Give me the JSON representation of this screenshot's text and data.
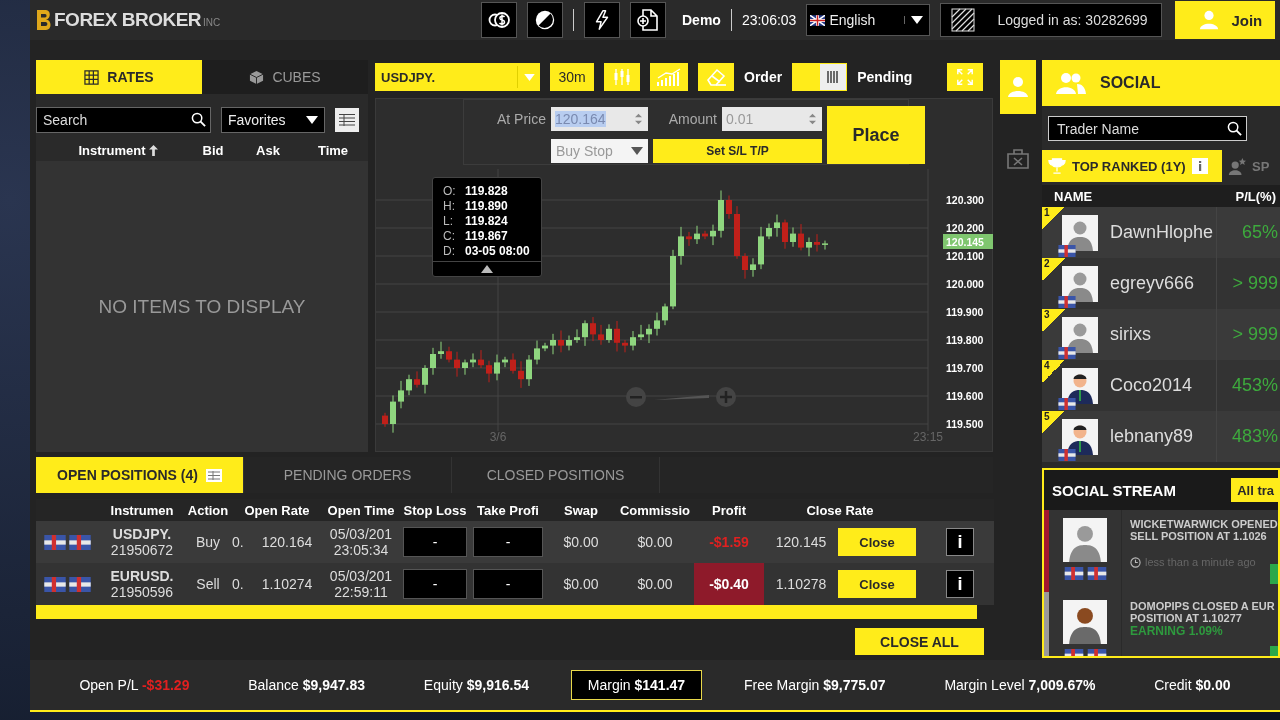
{
  "header": {
    "brand": "FOREX BROKER",
    "brand_suffix": "INC",
    "mode": "Demo",
    "time": "23:06:03",
    "language": "English",
    "logged_in": "Logged in as: 30282699",
    "join": "Join"
  },
  "rates_panel": {
    "tabs": [
      {
        "label": "RATES",
        "selected": true
      },
      {
        "label": "CUBES",
        "selected": false
      }
    ],
    "search": {
      "placeholder": "Search"
    },
    "filter": "Favorites",
    "columns": [
      "Instrument",
      "Bid",
      "Ask",
      "Time"
    ],
    "empty_message": "NO ITEMS TO DISPLAY"
  },
  "chart_panel": {
    "symbol": "USDJPY.",
    "timeframe": "30m",
    "order_label": "Order",
    "pending_label": "Pending",
    "pending": true,
    "order_form": {
      "price_label": "At Price",
      "price": "120.164",
      "amount_label": "Amount",
      "amount": "0.01",
      "order_type": "Buy Stop",
      "sl_tp": "Set S/L T/P",
      "place": "Place"
    },
    "tooltip": [
      {
        "key": "O:",
        "value": "119.828"
      },
      {
        "key": "H:",
        "value": "119.890"
      },
      {
        "key": "L:",
        "value": "119.824"
      },
      {
        "key": "C:",
        "value": "119.867"
      },
      {
        "key": "D:",
        "value": "03-05 08:00"
      }
    ],
    "y_labels": [
      "120.300",
      "120.200",
      "120.100",
      "120.000",
      "119.900",
      "119.800",
      "119.700",
      "119.600",
      "119.500"
    ],
    "current_price": "120.145",
    "x_labels": [
      "3/6",
      "23:15"
    ]
  },
  "side_strip": [
    {
      "kind": "social",
      "selected": true
    },
    {
      "kind": "portfolio",
      "selected": false
    }
  ],
  "positions": {
    "tabs": [
      {
        "label": "OPEN POSITIONS (4)",
        "selected": true
      },
      {
        "label": "PENDING ORDERS",
        "selected": false
      },
      {
        "label": "CLOSED POSITIONS",
        "selected": false
      }
    ],
    "columns": [
      "Instrumen",
      "Action",
      "Open Rate",
      "Open Time",
      "Stop Loss",
      "Take Profi",
      "Swap",
      "Commissio",
      "Profit",
      "Close Rate"
    ],
    "rows": [
      {
        "symbol": "USDJPY.",
        "ticket": "21950672",
        "action": "Buy",
        "amount": "0.",
        "open_rate": "120.164",
        "open_date": "05/03/201",
        "open_clock": "23:05:34",
        "stop_loss": "-",
        "take_profit": "-",
        "swap": "$0.00",
        "commission": "$0.00",
        "profit": "-$1.59",
        "highlighted": false,
        "close_rate": "120.145",
        "close": "Close",
        "info": "i"
      },
      {
        "symbol": "EURUSD.",
        "ticket": "21950596",
        "action": "Sell",
        "amount": "0.",
        "open_rate": "1.10274",
        "open_date": "05/03/201",
        "open_clock": "22:59:11",
        "stop_loss": "-",
        "take_profit": "-",
        "swap": "$0.00",
        "commission": "$0.00",
        "profit": "-$0.40",
        "highlighted": true,
        "close_rate": "1.10278",
        "close": "Close",
        "info": "i"
      }
    ],
    "close_all": "CLOSE ALL"
  },
  "social": {
    "title": "SOCIAL",
    "search": {
      "placeholder": "Trader Name"
    },
    "tabs": [
      {
        "label": "TOP RANKED (1Y)",
        "selected": true
      },
      {
        "label": "SP",
        "selected": false
      }
    ],
    "columns": [
      "NAME",
      "P/L(%)"
    ],
    "traders": [
      {
        "kind": "default",
        "rank": "1",
        "name": "DawnHlophe",
        "pl": "65%"
      },
      {
        "kind": "default",
        "rank": "2",
        "name": "egreyv666",
        "pl": "> 999"
      },
      {
        "kind": "default",
        "rank": "3",
        "name": "sirixs",
        "pl": "> 999"
      },
      {
        "kind": "illustrated",
        "rank": "4",
        "name": "Coco2014",
        "pl": "453%"
      },
      {
        "kind": "illustrated",
        "rank": "5",
        "name": "lebnany89",
        "pl": "483%"
      }
    ]
  },
  "social_stream": {
    "title": "SOCIAL STREAM",
    "filter": "All tra",
    "entries": [
      {
        "kind": "default",
        "color": "#a3182f",
        "lines": [
          "WICKETWARWICK OPENED",
          "SELL POSITION AT **1.1026**"
        ],
        "time": "less than a minute ago"
      },
      {
        "kind": "dark",
        "color": "#9a9a9a",
        "lines": [
          "DOMOPIPS CLOSED A **EUR**",
          "POSITION AT **1.10277**"
        ],
        "earning": "EARNING 1.09%"
      }
    ]
  },
  "status_bar": [
    {
      "label": "Open P/L",
      "value": "-$31.29",
      "negative": true,
      "selected": false
    },
    {
      "label": "Balance",
      "value": "$9,947.83",
      "negative": false,
      "selected": false
    },
    {
      "label": "Equity",
      "value": "$9,916.54",
      "negative": false,
      "selected": false
    },
    {
      "label": "Margin",
      "value": "$141.47",
      "negative": false,
      "selected": true
    },
    {
      "label": "Free Margin",
      "value": "$9,775.07",
      "negative": false,
      "selected": false
    },
    {
      "label": "Margin Level",
      "value": "7,009.67%",
      "negative": false,
      "selected": false
    },
    {
      "label": "Credit",
      "value": "$0.00",
      "negative": false,
      "selected": false
    }
  ]
}
